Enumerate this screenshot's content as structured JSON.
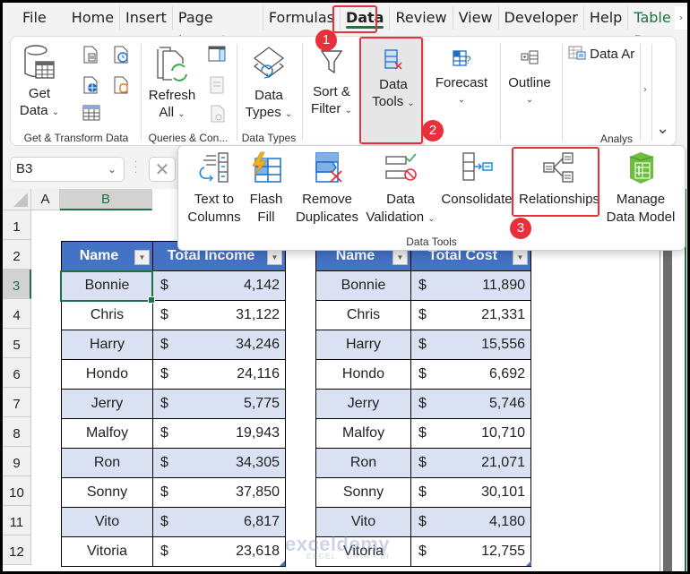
{
  "tabs": [
    {
      "label": "File"
    },
    {
      "label": "Home"
    },
    {
      "label": "Insert"
    },
    {
      "label": "Page Layout"
    },
    {
      "label": "Formulas"
    },
    {
      "label": "Data",
      "active": true
    },
    {
      "label": "Review"
    },
    {
      "label": "View"
    },
    {
      "label": "Developer"
    },
    {
      "label": "Help"
    },
    {
      "label": "Table D"
    }
  ],
  "tab_scroll_glyph": "›",
  "ribbon": {
    "get_transform": {
      "get_data_line1": "Get",
      "get_data_line2": "Data",
      "label": "Get & Transform Data"
    },
    "queries": {
      "refresh_line1": "Refresh",
      "refresh_line2": "All",
      "label": "Queries & Con..."
    },
    "data_types": {
      "line1": "Data",
      "line2": "Types",
      "label": "Data Types"
    },
    "sort_filter": {
      "line1": "Sort &",
      "line2": "Filter"
    },
    "data_tools": {
      "line1": "Data",
      "line2": "Tools"
    },
    "forecast": {
      "line1": "Forecast"
    },
    "outline": {
      "line1": "Outline"
    },
    "analysis": {
      "data_analysis": "Data Ar",
      "label": "Analys"
    },
    "scroll_glyph": "›",
    "collapse_glyph": "⌄",
    "caret": "⌄"
  },
  "data_tools_panel": {
    "label": "Data Tools",
    "buttons": [
      {
        "line1": "Text to",
        "line2": "Columns"
      },
      {
        "line1": "Flash",
        "line2": "Fill"
      },
      {
        "line1": "Remove",
        "line2": "Duplicates"
      },
      {
        "line1": "Data",
        "line2": "Validation"
      },
      {
        "line1": "Consolidate"
      },
      {
        "line1": "Relationships"
      },
      {
        "line1": "Manage",
        "line2": "Data Model"
      }
    ]
  },
  "steps": [
    "1",
    "2",
    "3"
  ],
  "formula_bar": {
    "name_box": "B3",
    "name_box_dropdown": "⌄",
    "cancel_glyph": "✕"
  },
  "grid": {
    "columns": [
      "A",
      "B"
    ],
    "rows": [
      "1",
      "2",
      "3",
      "4",
      "5",
      "6",
      "7",
      "8",
      "9",
      "10",
      "11",
      "12"
    ],
    "selected_column": "B",
    "selected_row": "3"
  },
  "income_table": {
    "headers": [
      "Name",
      "Total Income"
    ],
    "currency": "$",
    "rows": [
      {
        "name": "Bonnie",
        "value": "4,142"
      },
      {
        "name": "Chris",
        "value": "31,122"
      },
      {
        "name": "Harry",
        "value": "34,246"
      },
      {
        "name": "Hondo",
        "value": "24,116"
      },
      {
        "name": "Jerry",
        "value": "5,775"
      },
      {
        "name": "Malfoy",
        "value": "19,943"
      },
      {
        "name": "Ron",
        "value": "34,305"
      },
      {
        "name": "Sonny",
        "value": "37,850"
      },
      {
        "name": "Vito",
        "value": "6,817"
      },
      {
        "name": "Vitoria",
        "value": "23,618"
      }
    ]
  },
  "cost_table": {
    "headers": [
      "Name",
      "Total Cost"
    ],
    "currency": "$",
    "rows": [
      {
        "name": "Bonnie",
        "value": "11,890"
      },
      {
        "name": "Chris",
        "value": "21,331"
      },
      {
        "name": "Harry",
        "value": "15,556"
      },
      {
        "name": "Hondo",
        "value": "6,692"
      },
      {
        "name": "Jerry",
        "value": "5,746"
      },
      {
        "name": "Malfoy",
        "value": "10,710"
      },
      {
        "name": "Ron",
        "value": "21,071"
      },
      {
        "name": "Sonny",
        "value": "30,101"
      },
      {
        "name": "Vito",
        "value": "4,180"
      },
      {
        "name": "Vitoria",
        "value": "12,755"
      }
    ]
  },
  "watermark": {
    "main": "exceldemy",
    "sub": "EXCEL · DATA · BI"
  },
  "colors": {
    "accent_green": "#1e7145",
    "table_header": "#4472c4",
    "band": "#d9e1f2",
    "highlight_red": "#e8303a"
  }
}
